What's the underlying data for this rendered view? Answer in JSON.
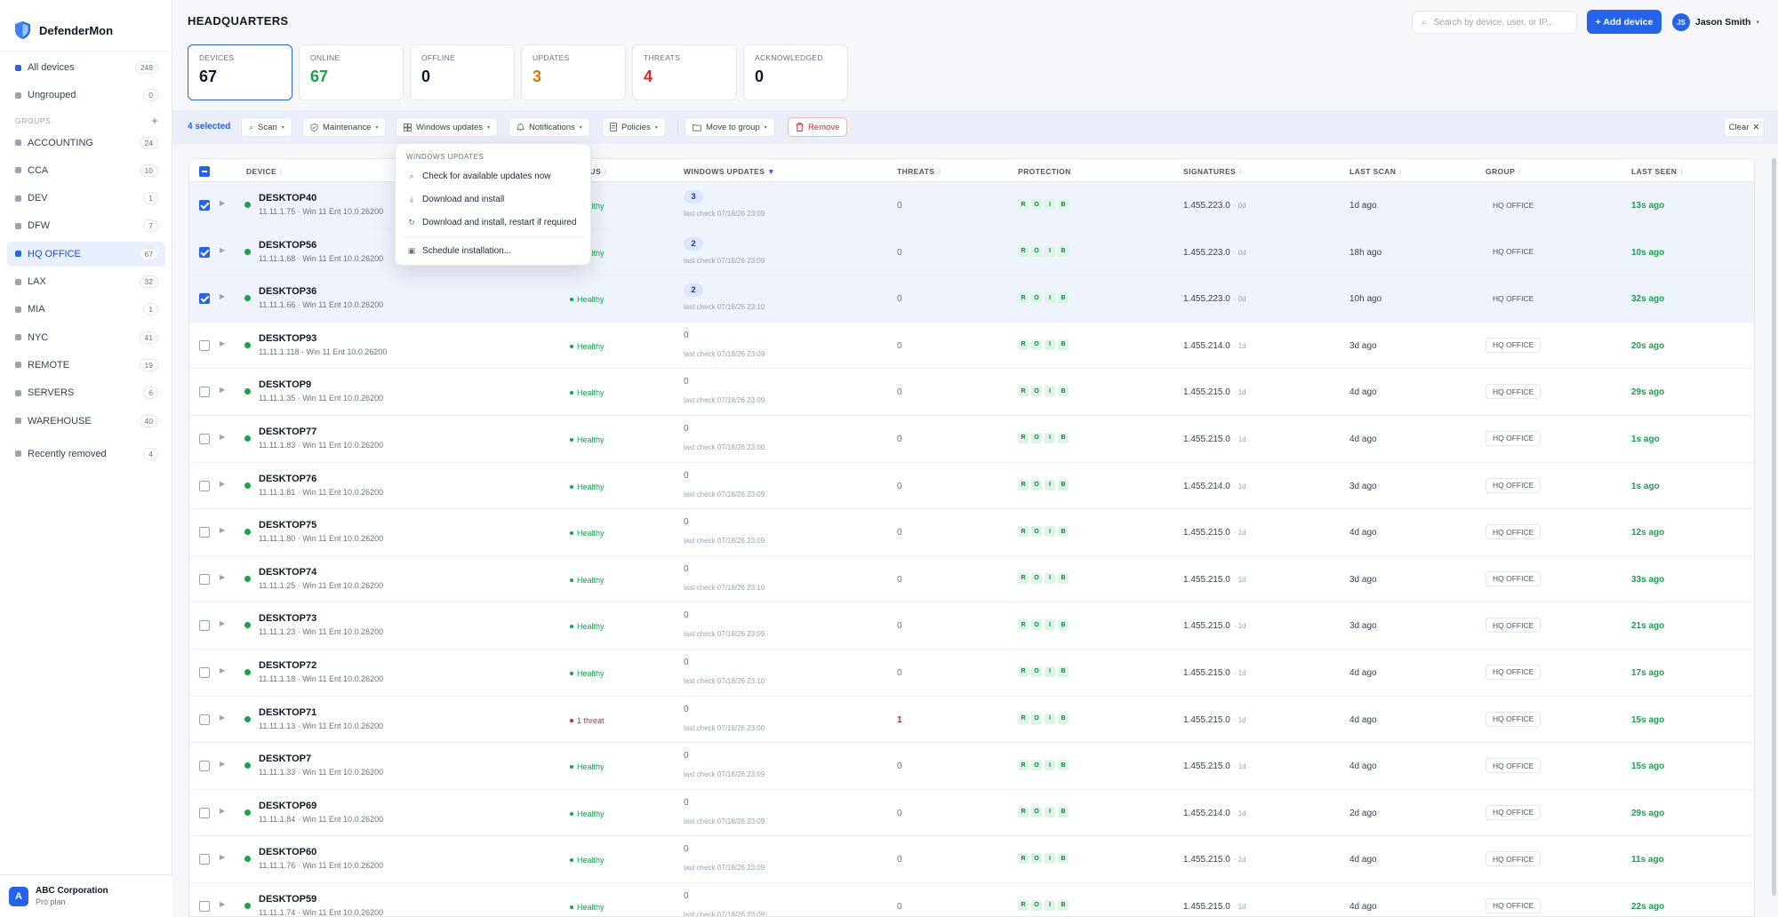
{
  "app": {
    "name": "DefenderMon"
  },
  "sidebar": {
    "all_devices": {
      "label": "All devices",
      "count": "248"
    },
    "ungrouped": {
      "label": "Ungrouped",
      "count": "0"
    },
    "groups_heading": "GROUPS",
    "groups_add": "+",
    "groups": [
      {
        "label": "ACCOUNTING",
        "count": "24"
      },
      {
        "label": "CCA",
        "count": "10"
      },
      {
        "label": "DEV",
        "count": "1"
      },
      {
        "label": "DFW",
        "count": "7"
      },
      {
        "label": "HQ OFFICE",
        "count": "67"
      },
      {
        "label": "LAX",
        "count": "32"
      },
      {
        "label": "MIA",
        "count": "1"
      },
      {
        "label": "NYC",
        "count": "41"
      },
      {
        "label": "REMOTE",
        "count": "19"
      },
      {
        "label": "SERVERS",
        "count": "6"
      },
      {
        "label": "WAREHOUSE",
        "count": "40"
      }
    ],
    "recently_removed": {
      "label": "Recently removed",
      "count": "4"
    },
    "org": {
      "initial": "A",
      "name": "ABC Corporation",
      "plan": "Pro plan"
    }
  },
  "header": {
    "title": "HEADQUARTERS",
    "search_placeholder": "Search by device, user, or IP...",
    "search_icon": "⌕",
    "add_device": "+ Add device",
    "user": {
      "initials": "JS",
      "name": "Jason Smith",
      "caret": "▾"
    }
  },
  "stats": [
    {
      "label": "DEVICES",
      "value": "67",
      "color": "#111827"
    },
    {
      "label": "ONLINE",
      "value": "67",
      "color": "#16a34a"
    },
    {
      "label": "OFFLINE",
      "value": "0",
      "color": "#111827"
    },
    {
      "label": "UPDATES",
      "value": "3",
      "color": "#d97706"
    },
    {
      "label": "THREATS",
      "value": "4",
      "color": "#dc2626"
    },
    {
      "label": "ACKNOWLEDGED",
      "value": "0",
      "color": "#111827"
    }
  ],
  "toolbar": {
    "selected": "4 selected",
    "scan": "Scan",
    "maintenance": "Maintenance",
    "windows_updates": "Windows updates",
    "notifications": "Notifications",
    "policies": "Policies",
    "move_to_group": "Move to group",
    "remove": "Remove",
    "clear": "Clear",
    "caret": "▾",
    "close_glyph": "✕"
  },
  "menu": {
    "heading": "WINDOWS UPDATES",
    "items": [
      {
        "label": "Check for available updates now",
        "icon": "search-icon",
        "glyph": "⌕"
      },
      {
        "label": "Download and install",
        "icon": "download-icon",
        "glyph": "⤓"
      },
      {
        "label": "Download and install, restart if required",
        "icon": "restart-icon",
        "glyph": "↻"
      },
      {
        "label": "Schedule installation...",
        "icon": "calendar-icon",
        "glyph": "▣"
      }
    ]
  },
  "table": {
    "columns": {
      "device": "DEVICE",
      "status": "STATUS",
      "windows_updates": "WINDOWS UPDATES",
      "threats": "THREATS",
      "protection": "PROTECTION",
      "signatures": "SIGNATURES",
      "last_scan": "LAST SCAN",
      "group": "GROUP",
      "last_seen": "LAST SEEN"
    },
    "sort_glyph": "↕",
    "sort_active_glyph": "▼",
    "protection_letters": [
      "R",
      "O",
      "I",
      "B"
    ],
    "rows": [
      {
        "selected": true,
        "name": "DESKTOP40",
        "sub": "11.11.1.75 · Win 11 Ent 10.0.26200",
        "status": "Healthy",
        "updates": "3",
        "update_check": "last check 07/18/26 23:09",
        "threats": "0",
        "signature": "1.455.223.0",
        "sig_age": "· 0d",
        "last_scan": "1d ago",
        "group": "HQ OFFICE",
        "last_seen": "13s ago"
      },
      {
        "selected": true,
        "name": "DESKTOP56",
        "sub": "11.11.1.68 · Win 11 Ent 10.0.26200",
        "status": "Healthy",
        "updates": "2",
        "update_check": "last check 07/18/26 23:09",
        "threats": "0",
        "signature": "1.455.223.0",
        "sig_age": "· 0d",
        "last_scan": "18h ago",
        "group": "HQ OFFICE",
        "last_seen": "10s ago"
      },
      {
        "selected": true,
        "name": "DESKTOP36",
        "sub": "11.11.1.66 · Win 11 Ent 10.0.26200",
        "status": "Healthy",
        "updates": "2",
        "update_check": "last check 07/18/26 23:10",
        "threats": "0",
        "signature": "1.455.223.0",
        "sig_age": "· 0d",
        "last_scan": "10h ago",
        "group": "HQ OFFICE",
        "last_seen": "32s ago"
      },
      {
        "selected": false,
        "name": "DESKTOP93",
        "sub": "11.11.1.118 · Win 11 Ent 10.0.26200",
        "status": "Healthy",
        "updates": "0",
        "update_check": "last check 07/18/26 23:09",
        "threats": "0",
        "signature": "1.455.214.0",
        "sig_age": "· 1d",
        "last_scan": "3d ago",
        "group": "HQ OFFICE",
        "last_seen": "20s ago"
      },
      {
        "selected": false,
        "name": "DESKTOP9",
        "sub": "11.11.1.35 · Win 11 Ent 10.0.26200",
        "status": "Healthy",
        "updates": "0",
        "update_check": "last check 07/18/26 23:09",
        "threats": "0",
        "signature": "1.455.215.0",
        "sig_age": "· 1d",
        "last_scan": "4d ago",
        "group": "HQ OFFICE",
        "last_seen": "29s ago"
      },
      {
        "selected": false,
        "name": "DESKTOP77",
        "sub": "11.11.1.83 · Win 11 Ent 10.0.26200",
        "status": "Healthy",
        "updates": "0",
        "update_check": "last check 07/18/26 23:00",
        "threats": "0",
        "signature": "1.455.215.0",
        "sig_age": "· 1d",
        "last_scan": "4d ago",
        "group": "HQ OFFICE",
        "last_seen": "1s ago"
      },
      {
        "selected": false,
        "name": "DESKTOP76",
        "sub": "11.11.1.81 · Win 11 Ent 10.0.26200",
        "status": "Healthy",
        "updates": "0",
        "update_check": "last check 07/18/26 23:09",
        "threats": "0",
        "signature": "1.455.214.0",
        "sig_age": "· 1d",
        "last_scan": "3d ago",
        "group": "HQ OFFICE",
        "last_seen": "1s ago"
      },
      {
        "selected": false,
        "name": "DESKTOP75",
        "sub": "11.11.1.80 · Win 11 Ent 10.0.26200",
        "status": "Healthy",
        "updates": "0",
        "update_check": "last check 07/18/26 23:09",
        "threats": "0",
        "signature": "1.455.215.0",
        "sig_age": "· 1d",
        "last_scan": "4d ago",
        "group": "HQ OFFICE",
        "last_seen": "12s ago"
      },
      {
        "selected": false,
        "name": "DESKTOP74",
        "sub": "11.11.1.25 · Win 11 Ent 10.0.26200",
        "status": "Healthy",
        "updates": "0",
        "update_check": "last check 07/18/26 23:10",
        "threats": "0",
        "signature": "1.455.215.0",
        "sig_age": "· 1d",
        "last_scan": "3d ago",
        "group": "HQ OFFICE",
        "last_seen": "33s ago"
      },
      {
        "selected": false,
        "name": "DESKTOP73",
        "sub": "11.11.1.23 · Win 11 Ent 10.0.26200",
        "status": "Healthy",
        "updates": "0",
        "update_check": "last check 07/18/26 23:09",
        "threats": "0",
        "signature": "1.455.215.0",
        "sig_age": "· 1d",
        "last_scan": "3d ago",
        "group": "HQ OFFICE",
        "last_seen": "21s ago"
      },
      {
        "selected": false,
        "name": "DESKTOP72",
        "sub": "11.11.1.18 · Win 11 Ent 10.0.26200",
        "status": "Healthy",
        "updates": "0",
        "update_check": "last check 07/18/26 23:10",
        "threats": "0",
        "signature": "1.455.215.0",
        "sig_age": "· 1d",
        "last_scan": "4d ago",
        "group": "HQ OFFICE",
        "last_seen": "17s ago"
      },
      {
        "selected": false,
        "name": "DESKTOP71",
        "sub": "11.11.1.13 · Win 11 Ent 10.0.26200",
        "status": "1 threat",
        "threat_status": true,
        "updates": "0",
        "update_check": "last check 07/18/26 23:00",
        "threats": "1",
        "signature": "1.455.215.0",
        "sig_age": "· 1d",
        "last_scan": "4d ago",
        "group": "HQ OFFICE",
        "last_seen": "15s ago"
      },
      {
        "selected": false,
        "name": "DESKTOP7",
        "sub": "11.11.1.33 · Win 11 Ent 10.0.26200",
        "status": "Healthy",
        "updates": "0",
        "update_check": "last check 07/18/26 23:09",
        "threats": "0",
        "signature": "1.455.215.0",
        "sig_age": "· 1d",
        "last_scan": "4d ago",
        "group": "HQ OFFICE",
        "last_seen": "15s ago"
      },
      {
        "selected": false,
        "name": "DESKTOP69",
        "sub": "11.11.1.84 · Win 11 Ent 10.0.26200",
        "status": "Healthy",
        "updates": "0",
        "update_check": "last check 07/18/26 23:09",
        "threats": "0",
        "signature": "1.455.214.0",
        "sig_age": "· 1d",
        "last_scan": "2d ago",
        "group": "HQ OFFICE",
        "last_seen": "29s ago"
      },
      {
        "selected": false,
        "name": "DESKTOP60",
        "sub": "11.11.1.76 · Win 11 Ent 10.0.26200",
        "status": "Healthy",
        "updates": "0",
        "update_check": "last check 07/18/26 23:09",
        "threats": "0",
        "signature": "1.455.215.0",
        "sig_age": "· 1d",
        "last_scan": "4d ago",
        "group": "HQ OFFICE",
        "last_seen": "11s ago"
      },
      {
        "selected": false,
        "name": "DESKTOP59",
        "sub": "11.11.1.74 · Win 11 Ent 10.0.26200",
        "status": "Healthy",
        "updates": "0",
        "update_check": "last check 07/18/26 23:09",
        "threats": "0",
        "signature": "1.455.215.0",
        "sig_age": "· 1d",
        "last_scan": "4d ago",
        "group": "HQ OFFICE",
        "last_seen": "22s ago"
      }
    ]
  },
  "colors": {
    "accent": "#2563eb",
    "healthy": "#16a34a",
    "danger": "#dc2626",
    "warning": "#d97706"
  }
}
